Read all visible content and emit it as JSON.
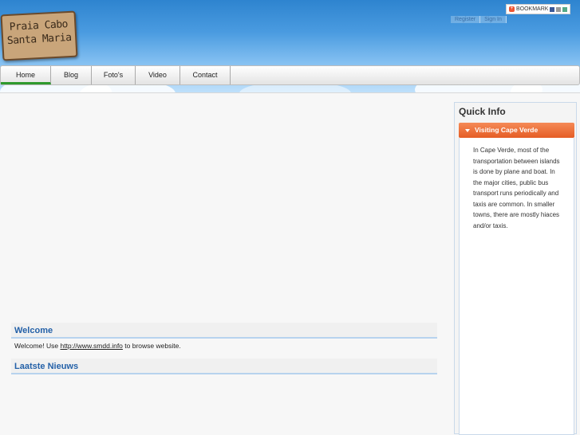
{
  "logo": {
    "line1": "Praia Cabo",
    "line2": "Santa Maria"
  },
  "bookmark": {
    "label": "BOOKMARK"
  },
  "toplinks": [
    "Register",
    "Sign In"
  ],
  "nav": [
    "Home",
    "Blog",
    "Foto's",
    "Video",
    "Contact"
  ],
  "main": {
    "welcome_title": "Welcome",
    "welcome_prefix": "Welcome! Use ",
    "welcome_link": "http://www.smdd.info",
    "welcome_suffix": " to browse website.",
    "news_title": "Laatste Nieuws"
  },
  "sidebar": {
    "title": "Quick Info",
    "accordion_title": "Visiting Cape Verde",
    "accordion_text": "In Cape Verde, most of the transportation between islands is done by plane and boat. In the major cities, public bus transport runs periodically and taxis are common. In smaller towns, there are mostly hiaces and/or taxis."
  },
  "colors": {
    "nav_active": "#2e9a2e",
    "accent": "#e55d25",
    "title_blue": "#2461a8"
  }
}
